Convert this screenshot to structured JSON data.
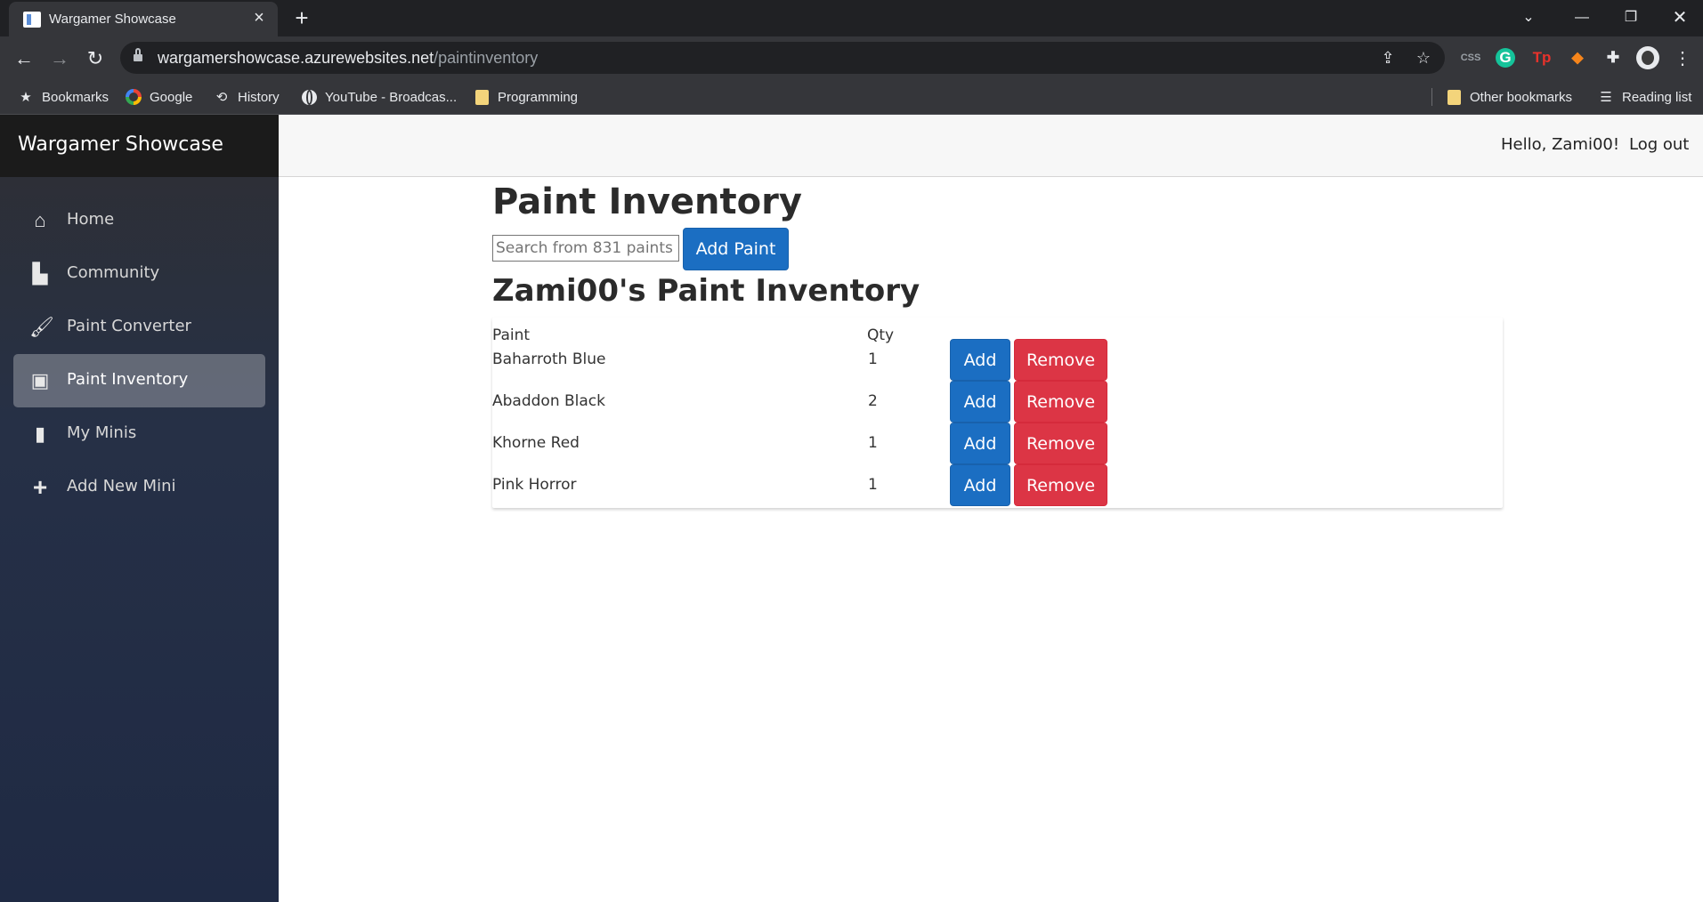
{
  "browser": {
    "tab_title": "Wargamer Showcase",
    "url_host": "wargamershowcase.azurewebsites.net",
    "url_path": "/paintinventory",
    "bookmarks": [
      {
        "label": "Bookmarks",
        "icon": "star-icon"
      },
      {
        "label": "Google",
        "icon": "google-icon"
      },
      {
        "label": "History",
        "icon": "history-icon"
      },
      {
        "label": "YouTube - Broadcas...",
        "icon": "globe-icon"
      },
      {
        "label": "Programming",
        "icon": "folder-icon"
      },
      {
        "label": "Other bookmarks",
        "icon": "folder-icon"
      },
      {
        "label": "Reading list",
        "icon": "reading-list-icon"
      }
    ]
  },
  "app": {
    "brand": "Wargamer Showcase",
    "nav": [
      {
        "label": "Home",
        "icon": "home-icon",
        "active": false
      },
      {
        "label": "Community",
        "icon": "book-icon",
        "active": false
      },
      {
        "label": "Paint Converter",
        "icon": "brush-icon",
        "active": false
      },
      {
        "label": "Paint Inventory",
        "icon": "box-icon",
        "active": true
      },
      {
        "label": "My Minis",
        "icon": "bookmark-icon",
        "active": false
      },
      {
        "label": "Add New Mini",
        "icon": "plus-icon",
        "active": false
      }
    ],
    "topbar": {
      "greeting": "Hello, Zami00!",
      "logout": "Log out"
    }
  },
  "main": {
    "title": "Paint Inventory",
    "search_placeholder": "Search from 831 paints",
    "add_paint_label": "Add Paint",
    "inventory_title": "Zami00's Paint Inventory",
    "table": {
      "headers": [
        "Paint",
        "Qty"
      ],
      "rows": [
        {
          "paint": "Baharroth Blue",
          "qty": "1"
        },
        {
          "paint": "Abaddon Black",
          "qty": "2"
        },
        {
          "paint": "Khorne Red",
          "qty": "1"
        },
        {
          "paint": "Pink Horror",
          "qty": "1"
        }
      ],
      "add_label": "Add",
      "remove_label": "Remove"
    }
  },
  "colors": {
    "primary": "#1b6ec2",
    "danger": "#dc3545",
    "sidebar_top": "#2f2f33",
    "sidebar_bottom": "#1f2a44"
  }
}
